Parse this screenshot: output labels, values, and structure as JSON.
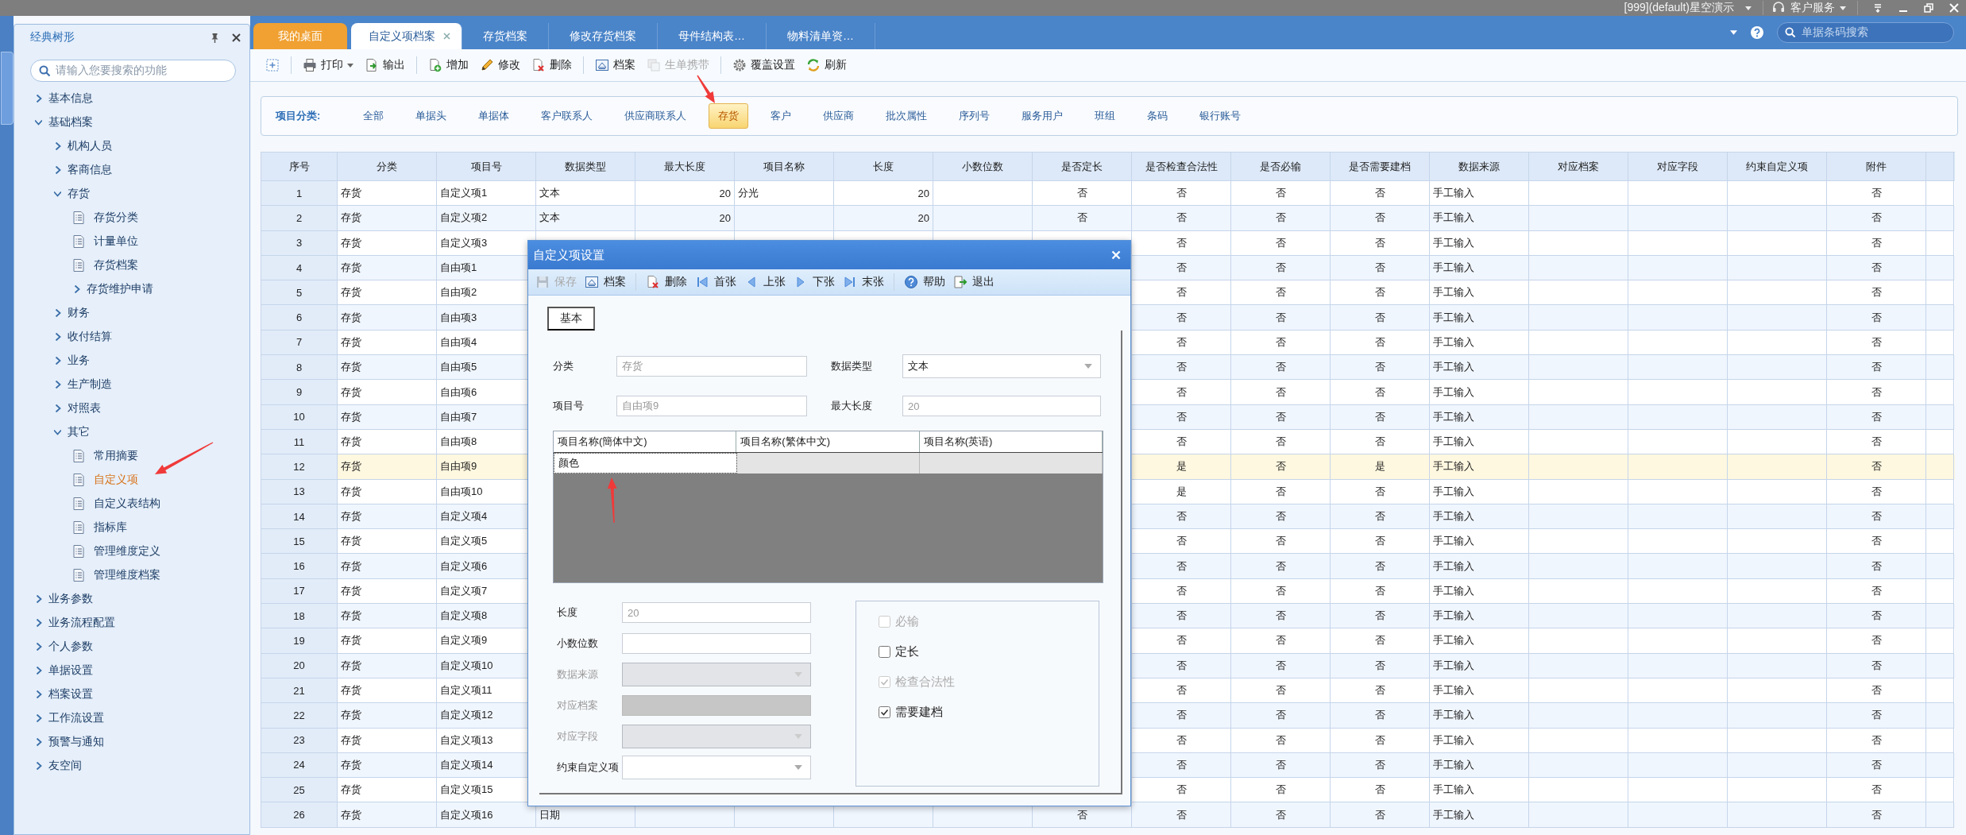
{
  "title_bar": {
    "account": "[999](default)星空演示",
    "service": "客户服务"
  },
  "sidebar": {
    "title": "经典树形",
    "search": {
      "placeholder": "请输入您要搜索的功能"
    },
    "items": [
      {
        "label": "基本信息",
        "kind": "folder",
        "expanded": false,
        "selected": false
      },
      {
        "label": "基础档案",
        "kind": "folder",
        "expanded": true,
        "selected": false,
        "children": [
          {
            "label": "机构人员",
            "kind": "folder",
            "expanded": false,
            "selected": false
          },
          {
            "label": "客商信息",
            "kind": "folder",
            "expanded": false,
            "selected": false
          },
          {
            "label": "存货",
            "kind": "folder",
            "expanded": true,
            "selected": false,
            "children": [
              {
                "label": "存货分类",
                "kind": "page",
                "selected": false
              },
              {
                "label": "计量单位",
                "kind": "page",
                "selected": false
              },
              {
                "label": "存货档案",
                "kind": "page",
                "selected": false
              },
              {
                "label": "存货维护申请",
                "kind": "folder",
                "expanded": false,
                "selected": false
              }
            ]
          },
          {
            "label": "财务",
            "kind": "folder",
            "expanded": false,
            "selected": false
          },
          {
            "label": "收付结算",
            "kind": "folder",
            "expanded": false,
            "selected": false
          },
          {
            "label": "业务",
            "kind": "folder",
            "expanded": false,
            "selected": false
          },
          {
            "label": "生产制造",
            "kind": "folder",
            "expanded": false,
            "selected": false
          },
          {
            "label": "对照表",
            "kind": "folder",
            "expanded": false,
            "selected": false
          },
          {
            "label": "其它",
            "kind": "folder",
            "expanded": true,
            "selected": false,
            "children": [
              {
                "label": "常用摘要",
                "kind": "page",
                "selected": false
              },
              {
                "label": "自定义项",
                "kind": "page",
                "selected": true
              },
              {
                "label": "自定义表结构",
                "kind": "page",
                "selected": false
              },
              {
                "label": "指标库",
                "kind": "page",
                "selected": false
              },
              {
                "label": "管理维度定义",
                "kind": "page",
                "selected": false
              },
              {
                "label": "管理维度档案",
                "kind": "page",
                "selected": false
              }
            ]
          }
        ]
      },
      {
        "label": "业务参数",
        "kind": "folder",
        "expanded": false,
        "selected": false
      },
      {
        "label": "业务流程配置",
        "kind": "folder",
        "expanded": false,
        "selected": false
      },
      {
        "label": "个人参数",
        "kind": "folder",
        "expanded": false,
        "selected": false
      },
      {
        "label": "单据设置",
        "kind": "folder",
        "expanded": false,
        "selected": false
      },
      {
        "label": "档案设置",
        "kind": "folder",
        "expanded": false,
        "selected": false
      },
      {
        "label": "工作流设置",
        "kind": "folder",
        "expanded": false,
        "selected": false
      },
      {
        "label": "预警与通知",
        "kind": "folder",
        "expanded": false,
        "selected": false
      },
      {
        "label": "友空间",
        "kind": "folder",
        "expanded": false,
        "selected": false
      }
    ]
  },
  "tabs": [
    {
      "label": "我的桌面",
      "kind": "home",
      "selected": false
    },
    {
      "label": "自定义项档案",
      "kind": "page",
      "selected": true
    },
    {
      "label": "存货档案",
      "kind": "page",
      "selected": false
    },
    {
      "label": "修改存货档案",
      "kind": "page",
      "selected": false
    },
    {
      "label": "母件结构表…",
      "kind": "page",
      "selected": false
    },
    {
      "label": "物料清单资…",
      "kind": "page",
      "selected": false
    }
  ],
  "barcode_search": {
    "placeholder": "单据条码搜索"
  },
  "toolbar": [
    [
      {
        "disabled": false
      }
    ],
    [
      {
        "label": "打印",
        "dropdown": true,
        "disabled": false
      },
      {
        "label": "输出",
        "disabled": false
      }
    ],
    [
      {
        "label": "增加",
        "disabled": false
      },
      {
        "label": "修改",
        "disabled": false
      },
      {
        "label": "删除",
        "disabled": false
      }
    ],
    [
      {
        "label": "档案",
        "disabled": false
      },
      {
        "label": "生单携带",
        "disabled": true
      }
    ],
    [
      {
        "label": "覆盖设置",
        "disabled": false
      },
      {
        "label": "刷新",
        "disabled": false
      }
    ]
  ],
  "category_filter": {
    "label": "项目分类:",
    "items": [
      {
        "label": "全部",
        "selected": false
      },
      {
        "label": "单据头",
        "selected": false
      },
      {
        "label": "单据体",
        "selected": false
      },
      {
        "label": "客户联系人",
        "selected": false
      },
      {
        "label": "供应商联系人",
        "selected": false
      },
      {
        "label": "存货",
        "selected": true
      },
      {
        "label": "客户",
        "selected": false
      },
      {
        "label": "供应商",
        "selected": false
      },
      {
        "label": "批次属性",
        "selected": false
      },
      {
        "label": "序列号",
        "selected": false
      },
      {
        "label": "服务用户",
        "selected": false
      },
      {
        "label": "班组",
        "selected": false
      },
      {
        "label": "条码",
        "selected": false
      },
      {
        "label": "银行账号",
        "selected": false
      }
    ]
  },
  "table": {
    "columns": [
      "序号",
      "分类",
      "项目号",
      "数据类型",
      "最大长度",
      "项目名称",
      "长度",
      "小数位数",
      "是否定长",
      "是否检查合法性",
      "是否必输",
      "是否需要建档",
      "数据来源",
      "对应档案",
      "对应字段",
      "约束自定义项",
      "附件"
    ],
    "rows": [
      {
        "no": "1",
        "category": "存货",
        "code": "自定义项1",
        "data_type": "文本",
        "max_length": "20",
        "name": "分光",
        "length": "20",
        "fixed_length": "否",
        "check_validity": "否",
        "required": "否",
        "need_archive": "否",
        "data_source": "手工输入",
        "attachment": "否",
        "selected": false
      },
      {
        "no": "2",
        "category": "存货",
        "code": "自定义项2",
        "data_type": "文本",
        "max_length": "20",
        "length": "20",
        "fixed_length": "否",
        "check_validity": "否",
        "required": "否",
        "need_archive": "否",
        "data_source": "手工输入",
        "attachment": "否",
        "selected": false
      },
      {
        "no": "3",
        "category": "存货",
        "code": "自定义项3",
        "check_validity": "否",
        "required": "否",
        "need_archive": "否",
        "data_source": "手工输入",
        "attachment": "否",
        "selected": false
      },
      {
        "no": "4",
        "category": "存货",
        "code": "自由项1",
        "check_validity": "否",
        "required": "否",
        "need_archive": "否",
        "data_source": "手工输入",
        "attachment": "否",
        "selected": false
      },
      {
        "no": "5",
        "category": "存货",
        "code": "自由项2",
        "check_validity": "否",
        "required": "否",
        "need_archive": "否",
        "data_source": "手工输入",
        "attachment": "否",
        "selected": false
      },
      {
        "no": "6",
        "category": "存货",
        "code": "自由项3",
        "check_validity": "否",
        "required": "否",
        "need_archive": "否",
        "data_source": "手工输入",
        "attachment": "否",
        "selected": false
      },
      {
        "no": "7",
        "category": "存货",
        "code": "自由项4",
        "check_validity": "否",
        "required": "否",
        "need_archive": "否",
        "data_source": "手工输入",
        "attachment": "否",
        "selected": false
      },
      {
        "no": "8",
        "category": "存货",
        "code": "自由项5",
        "check_validity": "否",
        "required": "否",
        "need_archive": "否",
        "data_source": "手工输入",
        "attachment": "否",
        "selected": false
      },
      {
        "no": "9",
        "category": "存货",
        "code": "自由项6",
        "check_validity": "否",
        "required": "否",
        "need_archive": "否",
        "data_source": "手工输入",
        "attachment": "否",
        "selected": false
      },
      {
        "no": "10",
        "category": "存货",
        "code": "自由项7",
        "check_validity": "否",
        "required": "否",
        "need_archive": "否",
        "data_source": "手工输入",
        "attachment": "否",
        "selected": false
      },
      {
        "no": "11",
        "category": "存货",
        "code": "自由项8",
        "check_validity": "否",
        "required": "否",
        "need_archive": "否",
        "data_source": "手工输入",
        "attachment": "否",
        "selected": false
      },
      {
        "no": "12",
        "category": "存货",
        "code": "自由项9",
        "check_validity": "是",
        "required": "否",
        "need_archive": "是",
        "data_source": "手工输入",
        "attachment": "否",
        "selected": true
      },
      {
        "no": "13",
        "category": "存货",
        "code": "自由项10",
        "check_validity": "是",
        "required": "否",
        "need_archive": "否",
        "data_source": "手工输入",
        "attachment": "否",
        "selected": false
      },
      {
        "no": "14",
        "category": "存货",
        "code": "自定义项4",
        "check_validity": "否",
        "required": "否",
        "need_archive": "否",
        "data_source": "手工输入",
        "attachment": "否",
        "selected": false
      },
      {
        "no": "15",
        "category": "存货",
        "code": "自定义项5",
        "check_validity": "否",
        "required": "否",
        "need_archive": "否",
        "data_source": "手工输入",
        "attachment": "否",
        "selected": false
      },
      {
        "no": "16",
        "category": "存货",
        "code": "自定义项6",
        "check_validity": "否",
        "required": "否",
        "need_archive": "否",
        "data_source": "手工输入",
        "attachment": "否",
        "selected": false
      },
      {
        "no": "17",
        "category": "存货",
        "code": "自定义项7",
        "check_validity": "否",
        "required": "否",
        "need_archive": "否",
        "data_source": "手工输入",
        "attachment": "否",
        "selected": false
      },
      {
        "no": "18",
        "category": "存货",
        "code": "自定义项8",
        "check_validity": "否",
        "required": "否",
        "need_archive": "否",
        "data_source": "手工输入",
        "attachment": "否",
        "selected": false
      },
      {
        "no": "19",
        "category": "存货",
        "code": "自定义项9",
        "check_validity": "否",
        "required": "否",
        "need_archive": "否",
        "data_source": "手工输入",
        "attachment": "否",
        "selected": false
      },
      {
        "no": "20",
        "category": "存货",
        "code": "自定义项10",
        "check_validity": "否",
        "required": "否",
        "need_archive": "否",
        "data_source": "手工输入",
        "attachment": "否",
        "selected": false
      },
      {
        "no": "21",
        "category": "存货",
        "code": "自定义项11",
        "check_validity": "否",
        "required": "否",
        "need_archive": "否",
        "data_source": "手工输入",
        "attachment": "否",
        "selected": false
      },
      {
        "no": "22",
        "category": "存货",
        "code": "自定义项12",
        "check_validity": "否",
        "required": "否",
        "need_archive": "否",
        "data_source": "手工输入",
        "attachment": "否",
        "selected": false
      },
      {
        "no": "23",
        "category": "存货",
        "code": "自定义项13",
        "check_validity": "否",
        "required": "否",
        "need_archive": "否",
        "data_source": "手工输入",
        "attachment": "否",
        "selected": false
      },
      {
        "no": "24",
        "category": "存货",
        "code": "自定义项14",
        "check_validity": "否",
        "required": "否",
        "need_archive": "否",
        "data_source": "手工输入",
        "attachment": "否",
        "selected": false
      },
      {
        "no": "25",
        "category": "存货",
        "code": "自定义项15",
        "check_validity": "否",
        "required": "否",
        "need_archive": "否",
        "data_source": "手工输入",
        "attachment": "否",
        "selected": false
      },
      {
        "no": "26",
        "category": "存货",
        "code": "自定义项16",
        "data_type": "日期",
        "fixed_length": "否",
        "check_validity": "否",
        "required": "否",
        "need_archive": "否",
        "data_source": "手工输入",
        "attachment": "否",
        "selected": false
      }
    ]
  },
  "dialog": {
    "title": "自定义项设置",
    "toolbar": [
      [
        {
          "label": "保存",
          "disabled": true
        },
        {
          "label": "档案",
          "disabled": false
        }
      ],
      [
        {
          "label": "删除",
          "disabled": false
        },
        {
          "label": "首张",
          "disabled": false
        },
        {
          "label": "上张",
          "disabled": false
        },
        {
          "label": "下张",
          "disabled": false
        },
        {
          "label": "末张",
          "disabled": false
        }
      ],
      [
        {
          "label": "帮助",
          "disabled": false
        },
        {
          "label": "退出",
          "disabled": false
        }
      ]
    ],
    "tabs": [
      {
        "label": "基本",
        "selected": true
      }
    ],
    "fields": [
      {
        "label": "分类",
        "kind": "text",
        "disabled": true,
        "value": "存货"
      },
      {
        "label": "数据类型",
        "kind": "select",
        "disabled": false,
        "value": "文本"
      },
      {
        "label": "项目号",
        "kind": "text",
        "disabled": true,
        "value": "自由项9"
      },
      {
        "label": "最大长度",
        "kind": "text",
        "disabled": true,
        "value": "20"
      }
    ],
    "name_grid": {
      "columns": [
        "项目名称(簡体中文)",
        "项目名称(繁体中文)",
        "项目名称(英语)"
      ],
      "cells": [
        {
          "value": "颜色",
          "disabled": false
        },
        {
          "disabled": true
        },
        {
          "disabled": true
        }
      ]
    },
    "detail_fields": [
      {
        "label": "长度",
        "kind": "text",
        "disabled": true,
        "value": "20"
      },
      {
        "label": "小数位数",
        "kind": "text",
        "disabled": false
      },
      {
        "label": "数据来源",
        "kind": "select",
        "disabled": true
      },
      {
        "label": "对应档案",
        "kind": "text",
        "disabled": true
      },
      {
        "label": "对应字段",
        "kind": "select",
        "disabled": true
      },
      {
        "label": "约束自定义项",
        "kind": "select",
        "disabled": false
      }
    ],
    "options": [
      {
        "label": "必输",
        "checked": false,
        "disabled": true
      },
      {
        "label": "定长",
        "checked": false,
        "disabled": false
      },
      {
        "label": "检查合法性",
        "checked": true,
        "disabled": true
      },
      {
        "label": "需要建档",
        "checked": true,
        "disabled": false
      }
    ]
  }
}
